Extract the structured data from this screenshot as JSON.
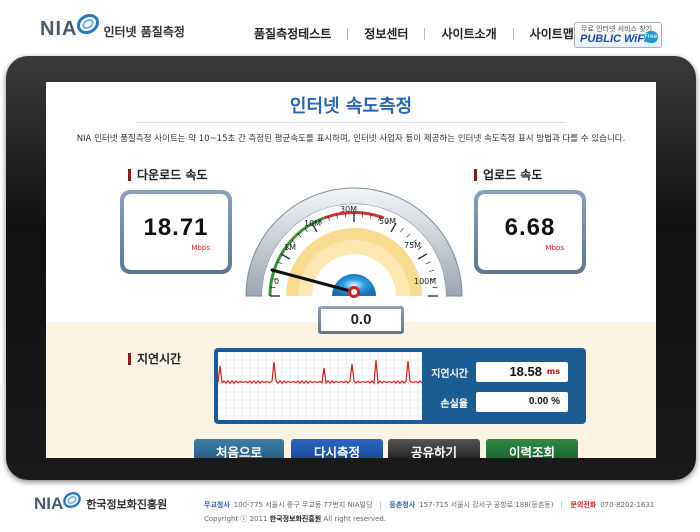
{
  "header": {
    "logo_nia": "NIA",
    "logo_sub": "인터넷 품질측정",
    "nav": [
      "품질측정테스트",
      "정보센터",
      "사이트소개",
      "사이트맵"
    ],
    "pw_top": "무료 인터넷 서비스 찾기",
    "pw_main": "PUBLIC WiFi",
    "pw_free": "Free"
  },
  "main": {
    "title": "인터넷 속도측정",
    "description": "NIA 인터넷 품질측정 사이트는 약 10~15초 간 측정된 평균속도를 표시하며, 인터넷 사업자 등이 제공하는 인터넷 속도측정 표시 방법과 다를 수 있습니다.",
    "download": {
      "label": "다운로드 속도",
      "value": "18.71",
      "unit": "Mbps"
    },
    "upload": {
      "label": "업로드 속도",
      "value": "6.68",
      "unit": "Mbps"
    },
    "gauge": {
      "ticks": [
        "0",
        "1M",
        "10M",
        "30M",
        "50M",
        "75M",
        "100M"
      ],
      "current_value": "0.0",
      "needle_level": 0
    },
    "latency": {
      "section_label": "지연시간",
      "delay_label": "지연시간",
      "delay_value": "18.58",
      "delay_unit": "ms",
      "loss_label": "손실율",
      "loss_value": "0.00 %"
    },
    "buttons": [
      "처음으로",
      "다시측정",
      "공유하기",
      "이력조회"
    ]
  },
  "footer": {
    "logo_nia": "NIA",
    "org_name": "한국정보화진흥원",
    "hq_label": "무교청사",
    "hq_addr": "100-775 서울시 중구 무교동 77번지 NIA빌딩",
    "branch_label": "등촌청사",
    "branch_addr": "157-715 서울시 강서구 공항로 188(등촌동)",
    "phone_label": "문의전화",
    "phone": "070-8202-1631",
    "copyright_pre": "Copyright ⓒ 2011",
    "copyright_org": "한국정보화진흥원",
    "copyright_post": "All right reserved."
  },
  "colors": {
    "title_blue": "#2a65b4",
    "panel_blue": "#1b5c93",
    "latency_bg": "#fdf3e3",
    "gauge_yellow": "#f7d57a",
    "graph_line": "#d21f1f"
  }
}
